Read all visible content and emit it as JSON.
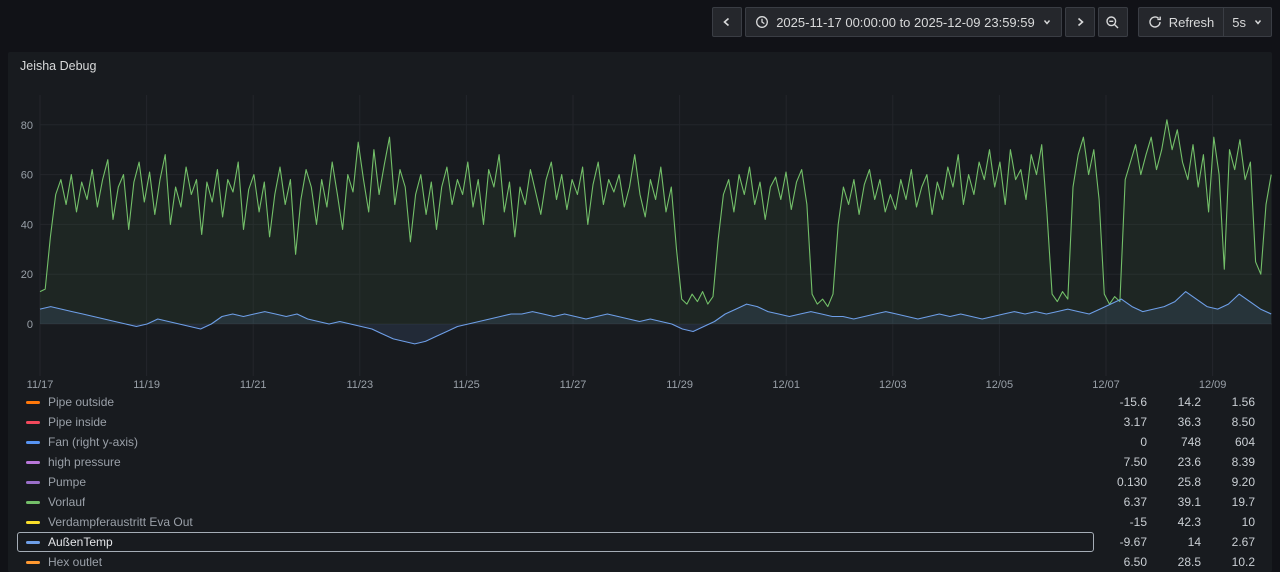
{
  "toolbar": {
    "time_range_label": "2025-11-17 00:00:00 to 2025-12-09 23:59:59",
    "refresh_label": "Refresh",
    "refresh_interval": "5s"
  },
  "panel": {
    "title": "Jeisha Debug"
  },
  "chart_data": {
    "type": "line",
    "title": "Jeisha Debug",
    "x_span_days": 23.1,
    "x_ticks": [
      "11/17",
      "11/19",
      "11/21",
      "11/23",
      "11/25",
      "11/27",
      "11/29",
      "12/01",
      "12/03",
      "12/05",
      "12/07",
      "12/09"
    ],
    "y_ticks": [
      0,
      20,
      40,
      60,
      80
    ],
    "ylim": [
      -20,
      94
    ],
    "grid": true,
    "grid_color": "#23262b",
    "axis_color": "#99a0a8",
    "legend_position": "bottom",
    "series": [
      {
        "name": "Vorlauf",
        "color": "#73bf69",
        "fill_opacity": 0.07,
        "values": [
          13,
          14,
          35,
          52,
          58,
          48,
          60,
          45,
          57,
          50,
          62,
          47,
          58,
          66,
          42,
          55,
          60,
          38,
          57,
          65,
          49,
          61,
          44,
          58,
          68,
          40,
          55,
          47,
          63,
          52,
          58,
          36,
          57,
          49,
          62,
          43,
          58,
          53,
          65,
          38,
          54,
          60,
          45,
          57,
          35,
          52,
          63,
          48,
          58,
          28,
          50,
          62,
          55,
          40,
          58,
          47,
          65,
          52,
          38,
          60,
          53,
          73,
          58,
          45,
          70,
          52,
          64,
          75,
          48,
          62,
          55,
          33,
          52,
          60,
          44,
          57,
          38,
          55,
          63,
          48,
          58,
          52,
          65,
          47,
          58,
          40,
          62,
          55,
          68,
          45,
          57,
          35,
          55,
          48,
          62,
          53,
          44,
          58,
          65,
          50,
          60,
          46,
          58,
          52,
          63,
          40,
          56,
          65,
          48,
          58,
          53,
          60,
          47,
          55,
          68,
          52,
          43,
          58,
          50,
          63,
          45,
          55,
          30,
          10,
          8,
          12,
          9,
          13,
          8,
          11,
          34,
          52,
          58,
          45,
          60,
          52,
          63,
          48,
          57,
          42,
          55,
          59,
          50,
          61,
          46,
          57,
          62,
          48,
          12,
          8,
          10,
          7,
          12,
          40,
          55,
          48,
          58,
          44,
          56,
          62,
          50,
          58,
          45,
          52,
          46,
          58,
          50,
          62,
          47,
          55,
          60,
          44,
          57,
          50,
          63,
          55,
          68,
          48,
          60,
          52,
          65,
          58,
          70,
          55,
          65,
          48,
          70,
          58,
          62,
          50,
          68,
          60,
          72,
          45,
          12,
          9,
          13,
          10,
          55,
          68,
          75,
          60,
          70,
          50,
          12,
          8,
          11,
          9,
          58,
          65,
          72,
          60,
          68,
          75,
          62,
          70,
          82,
          70,
          78,
          65,
          58,
          72,
          55,
          68,
          45,
          75,
          60,
          22,
          70,
          62,
          74,
          58,
          65,
          25,
          20,
          48,
          60
        ]
      },
      {
        "name": "AußenTemp",
        "color": "#6e9fe8",
        "fill_opacity": 0.12,
        "values": [
          6,
          7,
          6,
          5,
          4,
          3,
          2,
          1,
          0,
          -1,
          0,
          2,
          1,
          0,
          -1,
          -2,
          0,
          3,
          4,
          3,
          4,
          5,
          4,
          3,
          4,
          2,
          1,
          0,
          1,
          0,
          -1,
          -2,
          -4,
          -6,
          -7,
          -8,
          -7,
          -5,
          -3,
          -1,
          0,
          1,
          2,
          3,
          4,
          4,
          5,
          4,
          3,
          4,
          3,
          2,
          3,
          4,
          3,
          2,
          1,
          2,
          1,
          0,
          -2,
          -3,
          -1,
          1,
          4,
          6,
          8,
          7,
          5,
          4,
          3,
          4,
          5,
          4,
          3,
          3,
          2,
          3,
          4,
          5,
          4,
          3,
          2,
          3,
          4,
          3,
          4,
          3,
          2,
          3,
          4,
          5,
          4,
          5,
          4,
          5,
          6,
          5,
          4,
          6,
          8,
          10,
          7,
          5,
          6,
          7,
          9,
          13,
          10,
          7,
          6,
          8,
          12,
          9,
          6,
          4
        ]
      }
    ]
  },
  "legend": {
    "rows": [
      {
        "label": "Pipe outside",
        "color": "#ff780a",
        "values": [
          "-15.6",
          "14.2",
          "1.56"
        ],
        "selected": false
      },
      {
        "label": "Pipe inside",
        "color": "#f2495c",
        "values": [
          "3.17",
          "36.3",
          "8.50"
        ],
        "selected": false
      },
      {
        "label": "Fan (right y-axis)",
        "color": "#5794f2",
        "values": [
          "0",
          "748",
          "604"
        ],
        "selected": false
      },
      {
        "label": "high pressure",
        "color": "#b877d9",
        "values": [
          "7.50",
          "23.6",
          "8.39"
        ],
        "selected": false
      },
      {
        "label": "Pumpe",
        "color": "#9a6fc9",
        "values": [
          "0.130",
          "25.8",
          "9.20"
        ],
        "selected": false
      },
      {
        "label": "Vorlauf",
        "color": "#73bf69",
        "values": [
          "6.37",
          "39.1",
          "19.7"
        ],
        "selected": false
      },
      {
        "label": "Verdampferaustritt Eva Out",
        "color": "#fade2a",
        "values": [
          "-15",
          "42.3",
          "10"
        ],
        "selected": false
      },
      {
        "label": "AußenTemp",
        "color": "#6e9fe8",
        "values": [
          "-9.67",
          "14",
          "2.67"
        ],
        "selected": true
      },
      {
        "label": "Hex outlet",
        "color": "#ff9830",
        "values": [
          "6.50",
          "28.5",
          "10.2"
        ],
        "selected": false
      }
    ]
  }
}
